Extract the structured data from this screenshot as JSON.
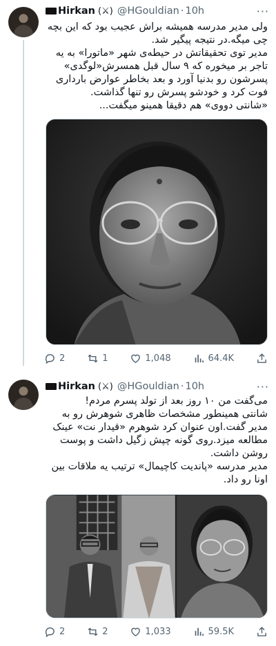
{
  "tweets": [
    {
      "author": {
        "name": "Hirkan",
        "handle": "@HGouldian",
        "time": "10h"
      },
      "text": "ولی مدیر مدرسه همیشه براش عجیب بود که این بچه چی میگه.در نتیجه پیگیر شد.\nمدیر توی تحقیقاتش در حیطه‌ی شهر «ماتورا» به یه تاجر بر میخوره که ۹ سال قبل همسرش«لوگدی» پسرشون رو بدنیا آورد و بعد بخاطر عوارض بارداری فوت کرد و خودشو پسرش رو تنها گذاشت.\n«شانتی دووی» هم دقیقا همینو میگفت...",
      "stats": {
        "replies": "2",
        "retweets": "1",
        "likes": "1,048",
        "views": "64.4K"
      }
    },
    {
      "author": {
        "name": "Hirkan",
        "handle": "@HGouldian",
        "time": "10h"
      },
      "text": "می‌گفت من ۱۰ روز بعد از تولد پسرم مردم!\nشانتی همینطور مشخصات ظاهری شوهرش رو به مدیر گفت.اون عنوان کرد شوهرم «قیدار نت» عینک مطالعه میزد.روی گونه چپش زگیل داشت و پوست روشن داشت.\nمدیر مدرسه «پاندیت کاچیمال» ترتیب یه ملاقات بین اونا رو داد.",
      "stats": {
        "replies": "2",
        "retweets": "2",
        "likes": "1,033",
        "views": "59.5K"
      }
    }
  ],
  "author_badge_icon": "crossed-swords-emoji",
  "icons": [
    "reply-icon",
    "retweet-icon",
    "like-icon",
    "views-icon",
    "share-icon",
    "more-icon"
  ],
  "colors": {
    "text": "#0f1419",
    "secondary": "#536471",
    "border": "#cfd9de"
  }
}
